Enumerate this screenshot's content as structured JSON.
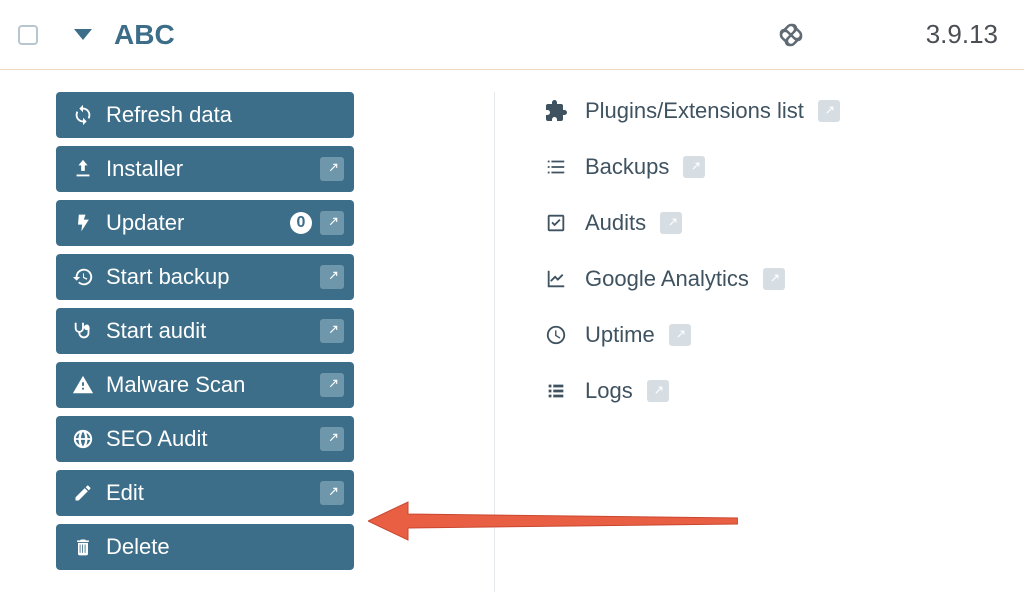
{
  "header": {
    "site_name": "ABC",
    "version": "3.9.13"
  },
  "actions": {
    "refresh": "Refresh data",
    "installer": "Installer",
    "updater": "Updater",
    "updater_count": "0",
    "start_backup": "Start backup",
    "start_audit": "Start audit",
    "malware_scan": "Malware Scan",
    "seo_audit": "SEO Audit",
    "edit": "Edit",
    "delete": "Delete"
  },
  "info": {
    "plugins": "Plugins/Extensions list",
    "backups": "Backups",
    "audits": "Audits",
    "analytics": "Google Analytics",
    "uptime": "Uptime",
    "logs": "Logs"
  }
}
